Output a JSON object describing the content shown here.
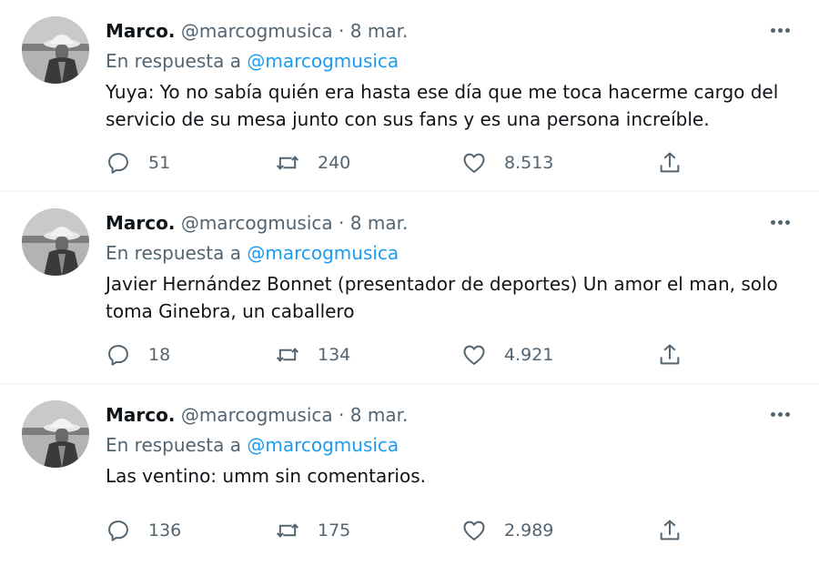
{
  "tweets": [
    {
      "name": "Marco.",
      "handle": "@marcogmusica",
      "separator": "·",
      "date": "8 mar.",
      "reply_prefix": "En respuesta a",
      "reply_to": "@marcogmusica",
      "text": "Yuya: Yo no sabía quién era hasta ese día que me toca hacerme cargo del servicio de su mesa junto con sus fans y es una persona increíble.",
      "replies": "51",
      "retweets": "240",
      "likes": "8.513"
    },
    {
      "name": "Marco.",
      "handle": "@marcogmusica",
      "separator": "·",
      "date": "8 mar.",
      "reply_prefix": "En respuesta a",
      "reply_to": "@marcogmusica",
      "text": "Javier Hernández Bonnet (presentador de deportes) Un amor el man, solo toma Ginebra, un caballero",
      "replies": "18",
      "retweets": "134",
      "likes": "4.921"
    },
    {
      "name": "Marco.",
      "handle": "@marcogmusica",
      "separator": "·",
      "date": "8 mar.",
      "reply_prefix": "En respuesta a",
      "reply_to": "@marcogmusica",
      "text": "Las ventino: umm sin comentarios.",
      "replies": "136",
      "retweets": "175",
      "likes": "2.989"
    }
  ],
  "icons": {
    "more": "more-horizontal-icon",
    "reply": "speech-bubble-icon",
    "retweet": "retweet-arrows-icon",
    "like": "heart-icon",
    "share": "share-upload-icon"
  },
  "colors": {
    "text": "#0f1419",
    "muted": "#536471",
    "link": "#1d9bf0",
    "divider": "#eff3f4"
  }
}
